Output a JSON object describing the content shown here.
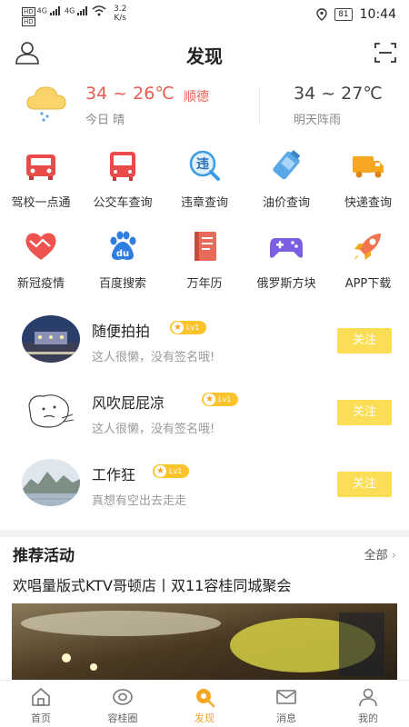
{
  "status_bar": {
    "hd1": "HD",
    "hd2": "HD",
    "sig1": "4G",
    "sig2": "4G",
    "net_speed": "3.2",
    "net_unit": "K/s",
    "battery": "81",
    "time": "10:44"
  },
  "header": {
    "title": "发现",
    "left_icon": "user-icon",
    "right_icon": "scan-icon"
  },
  "weather": {
    "today_temp": "34 ~ 26℃",
    "city": "顺德",
    "today_desc": "今日 晴",
    "tomorrow_temp": "34 ~ 27℃",
    "tomorrow_desc": "明天阵雨"
  },
  "services": [
    {
      "label": "驾校一点通",
      "icon": "car-icon"
    },
    {
      "label": "公交车查询",
      "icon": "bus-icon"
    },
    {
      "label": "违章查询",
      "icon": "violation-search-icon"
    },
    {
      "label": "油价查询",
      "icon": "fuel-icon"
    },
    {
      "label": "快递查询",
      "icon": "delivery-truck-icon"
    },
    {
      "label": "新冠疫情",
      "icon": "heart-icon"
    },
    {
      "label": "百度搜索",
      "icon": "baidu-icon"
    },
    {
      "label": "万年历",
      "icon": "calendar-book-icon"
    },
    {
      "label": "俄罗斯方块",
      "icon": "gamepad-icon"
    },
    {
      "label": "APP下载",
      "icon": "rocket-icon"
    }
  ],
  "users": [
    {
      "name": "随便拍拍",
      "level": "Lv1",
      "signature": "这人很懒，没有签名哦!",
      "follow": "关注"
    },
    {
      "name": "风吹屁屁凉",
      "level": "Lv1",
      "signature": "这人很懒，没有签名哦!",
      "follow": "关注"
    },
    {
      "name": "工作狂",
      "level": "Lv1",
      "signature": "真想有空出去走走",
      "follow": "关注"
    }
  ],
  "recommend": {
    "title": "推荐活动",
    "more": "全部",
    "event_title": "欢唱量版式KTV哥顿店丨双11容桂同城聚会"
  },
  "tabs": [
    {
      "label": "首页",
      "icon": "home-icon"
    },
    {
      "label": "容桂圈",
      "icon": "circle-icon"
    },
    {
      "label": "发现",
      "icon": "discover-icon",
      "active": true
    },
    {
      "label": "消息",
      "icon": "mail-icon"
    },
    {
      "label": "我的",
      "icon": "profile-icon"
    }
  ],
  "colors": {
    "accent": "#f5a623",
    "follow_button": "#fbde55",
    "temp_today": "#e85a4f"
  }
}
